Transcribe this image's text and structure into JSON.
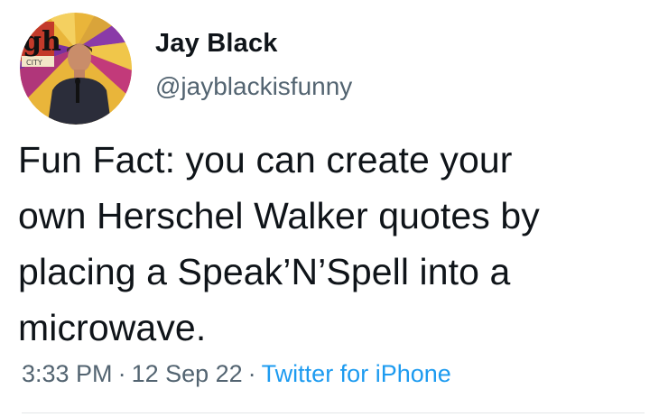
{
  "author": {
    "display_name": "Jay Black",
    "handle": "@jayblackisfunny",
    "avatar": {
      "icon": "profile-photo-icon",
      "logo_text": "gh",
      "logo_sub_text": "CITY"
    }
  },
  "tweet": {
    "lines": [
      "Fun Fact: you can create your",
      "own Herschel Walker quotes by",
      "placing a Speak’N’Spell into a",
      "microwave."
    ]
  },
  "meta": {
    "time": "3:33 PM",
    "separator": "·",
    "date": "12 Sep 22",
    "source": "Twitter for iPhone"
  },
  "colors": {
    "text": "#0f1419",
    "secondary": "#536471",
    "link": "#1d9bf0"
  }
}
